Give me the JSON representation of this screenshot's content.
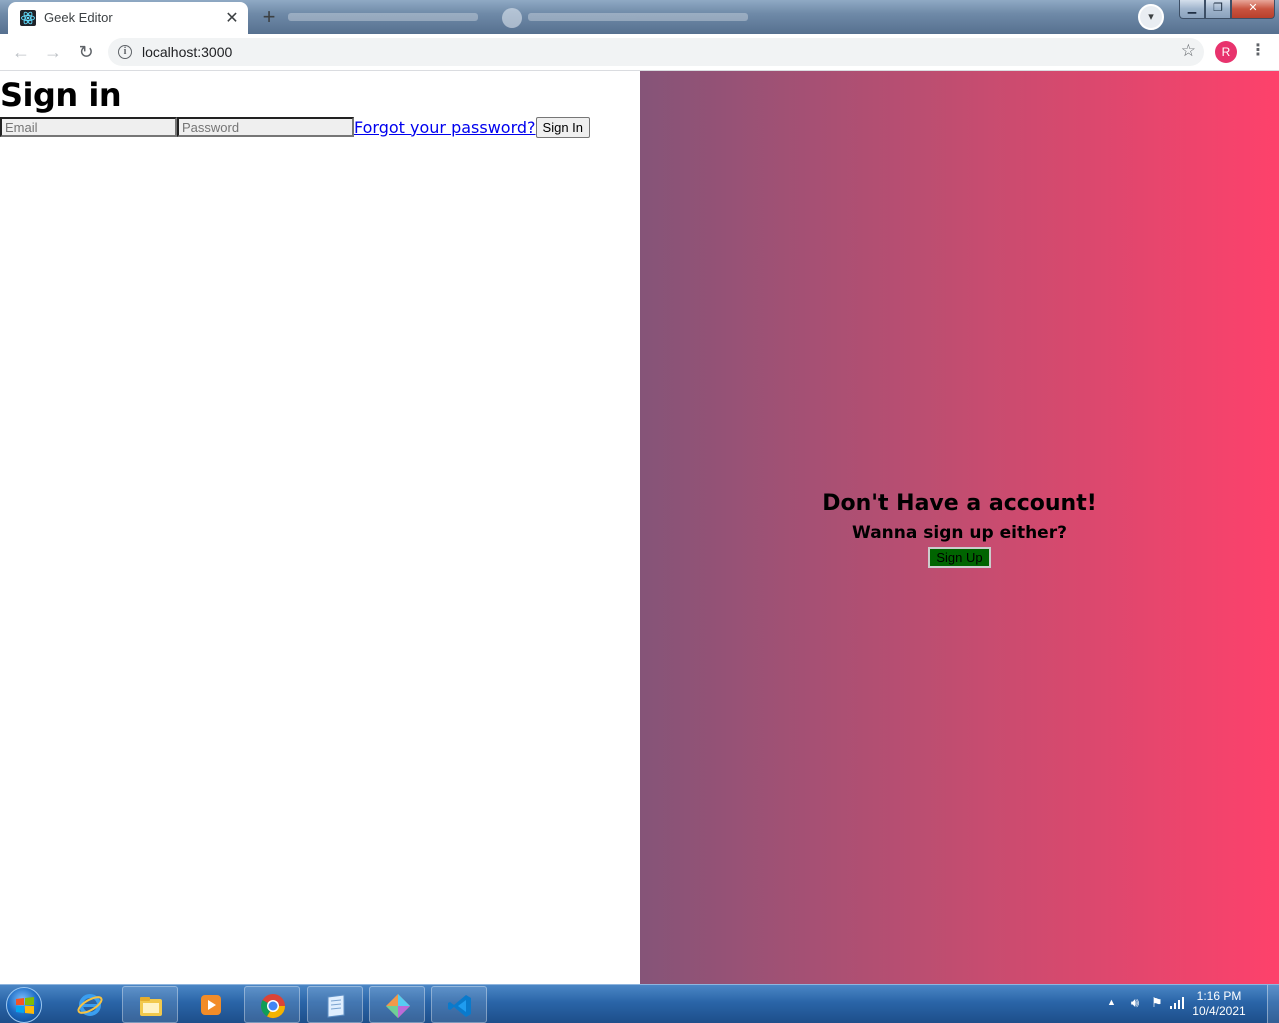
{
  "browser": {
    "active_tab_title": "Geek Editor",
    "tab_close_glyph": "✕",
    "new_tab_glyph": "+",
    "url": "localhost:3000",
    "profile_initial": "R",
    "profile_color": "#e8336d",
    "nav": {
      "back_glyph": "←",
      "forward_glyph": "→",
      "reload_glyph": "↻"
    },
    "bookmark_glyph": "☆",
    "menu_glyph": "⋮",
    "window_controls": {
      "minimize": "▁",
      "restore": "❐",
      "close": "✕"
    }
  },
  "signin": {
    "title": "Sign in",
    "email_placeholder": "Email",
    "password_placeholder": "Password",
    "forgot_link": "Forgot your password?",
    "submit_label": "Sign In"
  },
  "signup_panel": {
    "title": "Don't Have a account!",
    "subtitle": "Wanna sign up either?",
    "button_label": "Sign Up",
    "button_color": "#006400",
    "gradient": [
      "#855478",
      "#c24d70",
      "#fe416b"
    ]
  },
  "taskbar": {
    "apps": [
      "internet-explorer-icon",
      "file-explorer-icon",
      "media-player-icon",
      "chrome-icon",
      "notepad-icon",
      "git-icon",
      "vscode-icon"
    ],
    "tray_arrow": "▲",
    "clock_time": "1:16 PM",
    "clock_date": "10/4/2021"
  }
}
